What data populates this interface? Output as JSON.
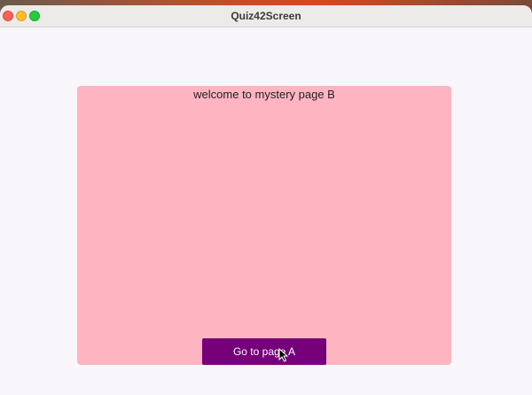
{
  "window": {
    "title": "Quiz42Screen"
  },
  "page": {
    "welcome_text": "welcome to mystery page B",
    "button_label": "Go to page A"
  },
  "colors": {
    "panel": "#ffb5c1",
    "button": "#760079",
    "window_bg": "#f8f6fa"
  },
  "icons": [
    "close-icon",
    "minimize-icon",
    "zoom-icon",
    "pointer-cursor-icon"
  ]
}
